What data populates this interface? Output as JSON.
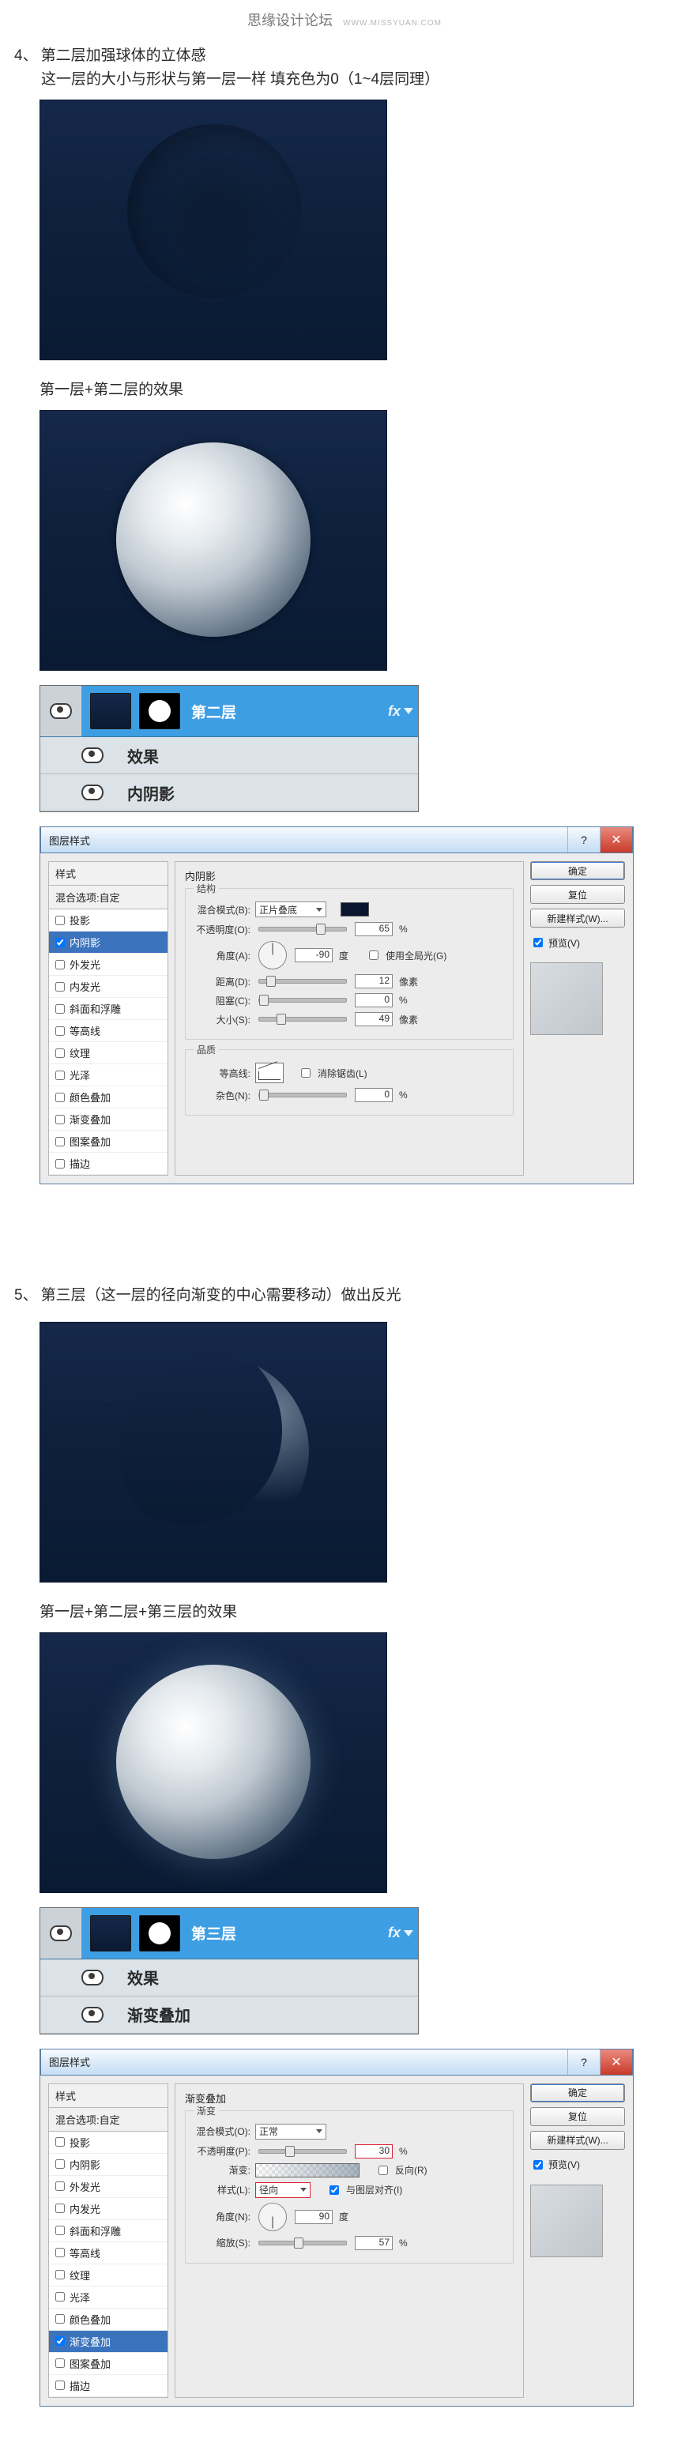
{
  "brand": {
    "title": "思缘设计论坛",
    "url": "WWW.MISSYUAN.COM"
  },
  "step4": {
    "num": "4、",
    "title": "第二层加强球体的立体感",
    "subline": "这一层的大小与形状与第一层一样   填充色为0（1~4层同理）",
    "caption_combo": "第一层+第二层的效果"
  },
  "step5": {
    "num": "5、",
    "title": "第三层（这一层的径向渐变的中心需要移动）做出反光",
    "caption_combo": "第一层+第二层+第三层的效果"
  },
  "layer_panel4": {
    "layer_name": "第二层",
    "fx_label": "fx",
    "row_effect": "效果",
    "row_style": "内阴影"
  },
  "layer_panel5": {
    "layer_name": "第三层",
    "fx_label": "fx",
    "row_effect": "效果",
    "row_style": "渐变叠加"
  },
  "dlg_common": {
    "title": "图层样式",
    "left_head1": "样式",
    "left_head2": "混合选项:自定",
    "style_list": [
      "投影",
      "内阴影",
      "外发光",
      "内发光",
      "斜面和浮雕",
      "等高线",
      "纹理",
      "光泽",
      "颜色叠加",
      "渐变叠加",
      "图案叠加",
      "描边"
    ],
    "btn_ok": "确定",
    "btn_reset": "复位",
    "btn_newstyle": "新建样式(W)...",
    "ck_preview": "预览(V)"
  },
  "dlg4": {
    "section_title": "内阴影",
    "group_struct": "结构",
    "label_mode": "混合模式(B):",
    "mode_value": "正片叠底",
    "label_opacity": "不透明度(O):",
    "opacity_value": "65",
    "unit_pct": "%",
    "label_angle": "角度(A):",
    "angle_value": "-90",
    "unit_deg": "度",
    "ck_global": "使用全局光(G)",
    "label_distance": "距离(D):",
    "distance_value": "12",
    "unit_px": "像素",
    "label_choke": "阻塞(C):",
    "choke_value": "0",
    "label_size": "大小(S):",
    "size_value": "49",
    "group_quality": "品质",
    "label_contour": "等高线:",
    "ck_antialias": "消除锯齿(L)",
    "label_noise": "杂色(N):",
    "noise_value": "0"
  },
  "dlg5": {
    "section_title": "渐变叠加",
    "group_grad": "渐变",
    "label_mode": "混合模式(O):",
    "mode_value": "正常",
    "label_opacity": "不透明度(P):",
    "opacity_value": "30",
    "unit_pct": "%",
    "label_gradient": "渐变:",
    "ck_reverse": "反向(R)",
    "label_style": "样式(L):",
    "style_value": "径向",
    "ck_align": "与图层对齐(I)",
    "label_angle": "角度(N):",
    "angle_value": "90",
    "unit_deg": "度",
    "label_scale": "缩放(S):",
    "scale_value": "57"
  }
}
